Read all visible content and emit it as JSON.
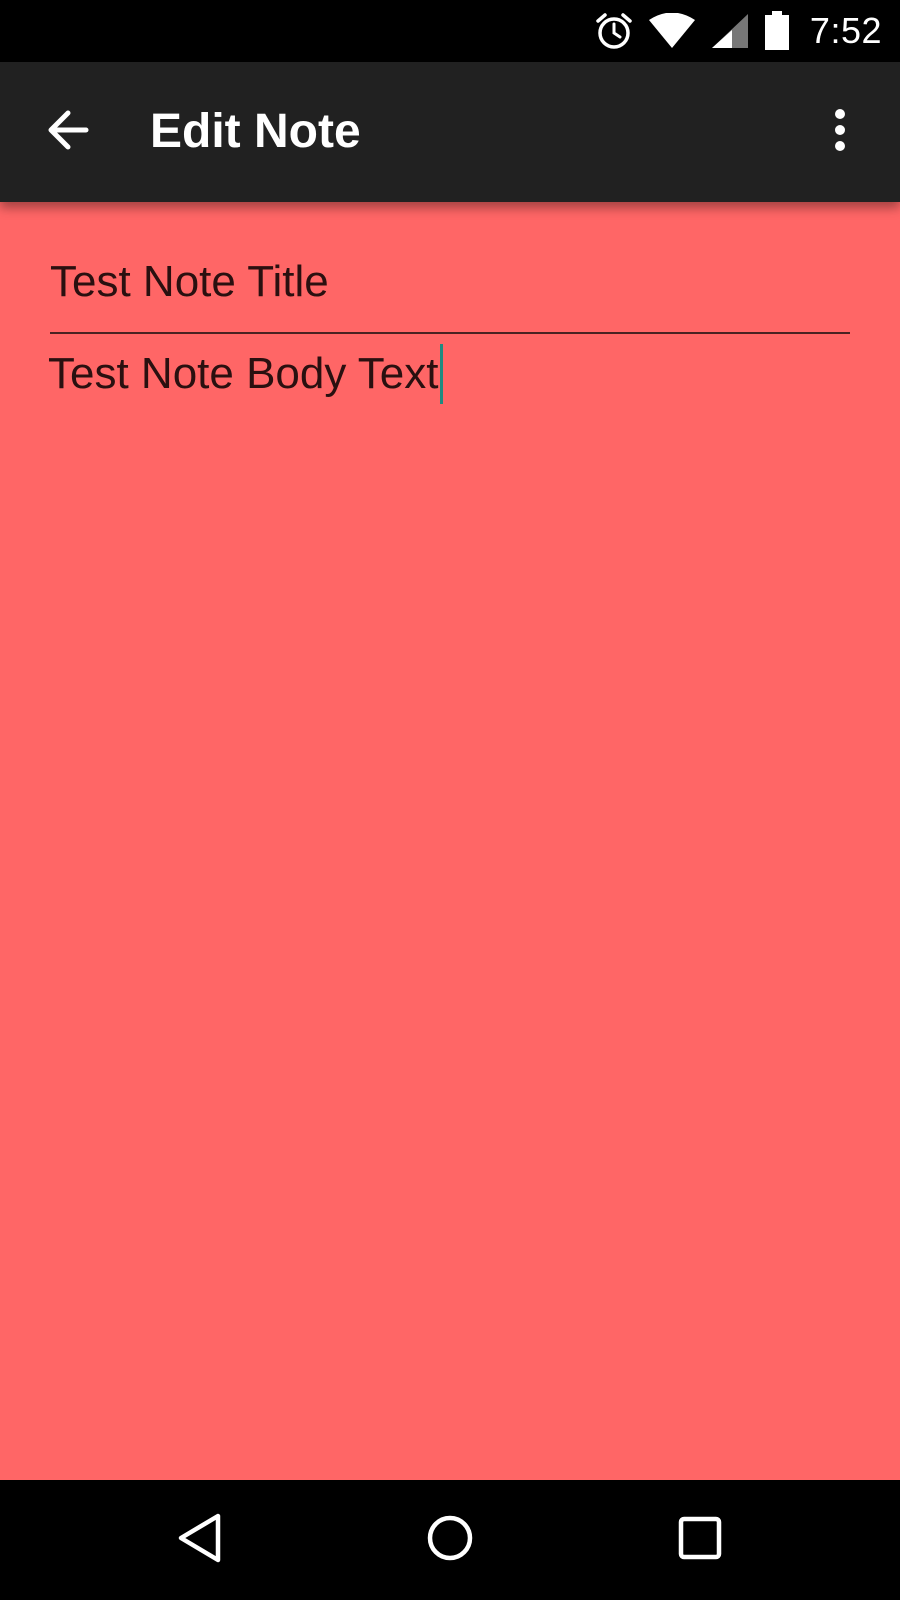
{
  "status_bar": {
    "time": "7:52",
    "icons": [
      "alarm-icon",
      "wifi-icon",
      "signal-icon",
      "battery-icon"
    ]
  },
  "app_bar": {
    "title": "Edit Note",
    "back_icon": "arrow-back-icon",
    "menu_icon": "more-vert-icon"
  },
  "note": {
    "title": "Test Note Title",
    "body": "Test Note Body Text",
    "background_color": "#ff6666"
  },
  "nav_bar": {
    "icons": [
      "back-triangle-icon",
      "home-circle-icon",
      "recents-square-icon"
    ]
  },
  "colors": {
    "app_bar": "#212121",
    "status_bar": "#000000",
    "cursor": "#1f8a80"
  }
}
